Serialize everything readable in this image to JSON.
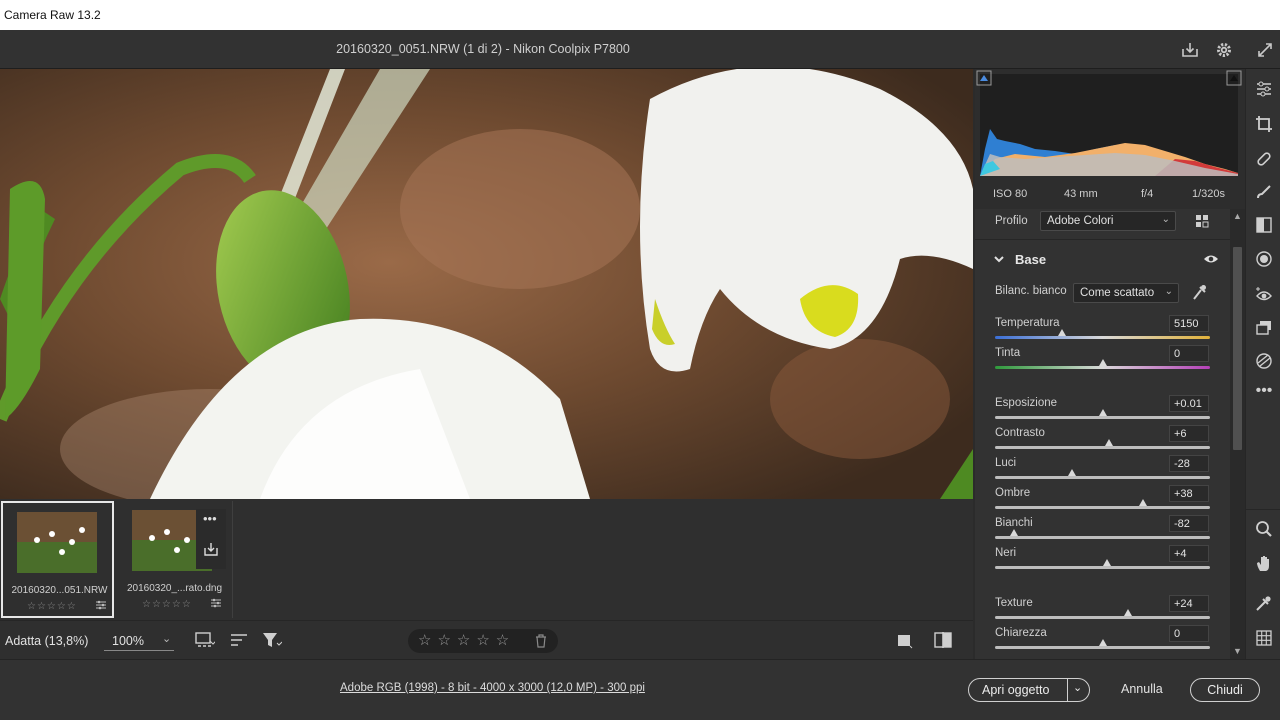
{
  "app": {
    "title": "Camera Raw 13.2"
  },
  "document": {
    "title": "20160320_0051.NRW (1 di 2)  -  Nikon Coolpix P7800"
  },
  "exif": {
    "iso": "ISO 80",
    "focal": "43 mm",
    "aperture": "f/4",
    "shutter": "1/320s"
  },
  "profile": {
    "label": "Profilo",
    "value": "Adobe Colori"
  },
  "base": {
    "title": "Base",
    "wb_label": "Bilanc. bianco",
    "wb_value": "Come scattato",
    "sliders": [
      {
        "label": "Temperatura",
        "value": "5150",
        "pos": 0.31
      },
      {
        "label": "Tinta",
        "value": "0",
        "pos": 0.5
      },
      {
        "label": "Esposizione",
        "value": "+0.01",
        "pos": 0.5
      },
      {
        "label": "Contrasto",
        "value": "+6",
        "pos": 0.53
      },
      {
        "label": "Luci",
        "value": "-28",
        "pos": 0.36
      },
      {
        "label": "Ombre",
        "value": "+38",
        "pos": 0.69
      },
      {
        "label": "Bianchi",
        "value": "-82",
        "pos": 0.09
      },
      {
        "label": "Neri",
        "value": "+4",
        "pos": 0.52
      },
      {
        "label": "Texture",
        "value": "+24",
        "pos": 0.62
      },
      {
        "label": "Chiarezza",
        "value": "0",
        "pos": 0.5
      }
    ]
  },
  "filmstrip": [
    {
      "name": "20160320...051.NRW",
      "stars": "☆☆☆☆☆"
    },
    {
      "name": "20160320_...rato.dng",
      "stars": "☆☆☆☆☆"
    }
  ],
  "toolbar": {
    "zoom_fit": "Adatta (13,8%)",
    "zoom_value": "100%",
    "rating_stars": "☆☆☆☆☆"
  },
  "footer": {
    "info_link": "Adobe RGB (1998) - 8 bit - 4000 x 3000 (12,0 MP) - 300 ppi",
    "open_label": "Apri oggetto",
    "cancel_label": "Annulla",
    "close_label": "Chiudi"
  }
}
